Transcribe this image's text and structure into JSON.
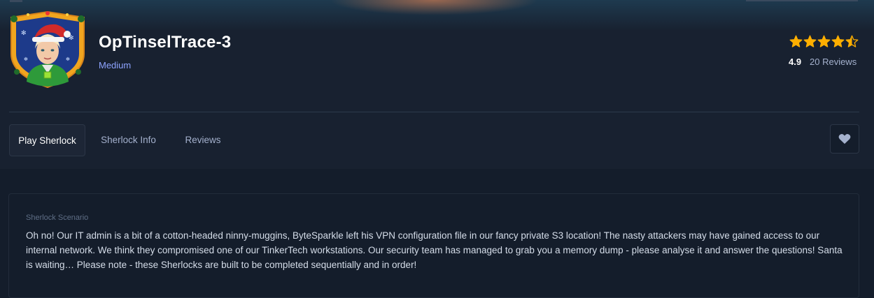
{
  "challenge": {
    "title": "OpTinselTrace-3",
    "difficulty": "Medium",
    "rating": "4.9",
    "reviews_label": "20 Reviews",
    "stars_filled": 4.5
  },
  "tabs": [
    {
      "label": "Play Sherlock",
      "active": true
    },
    {
      "label": "Sherlock Info",
      "active": false
    },
    {
      "label": "Reviews",
      "active": false
    }
  ],
  "favorite": {
    "icon": "heart-icon"
  },
  "scenario": {
    "label": "Sherlock Scenario",
    "text": "Oh no! Our IT admin is a bit of a cotton-headed ninny-muggins, ByteSparkle left his VPN configuration file in our fancy private S3 location! The nasty attackers may have gained access to our internal network. We think they compromised one of our TinkerTech workstations. Our security team has managed to grab you a memory dump - please analyse it and answer the questions! Santa is waiting…   Please note - these Sherlocks are built to be completed sequentially and in order!"
  },
  "colors": {
    "background": "#141d2b",
    "header": "#182130",
    "accent_difficulty": "#8ea4ff",
    "star": "#ffaf00",
    "text_muted": "#a4b1cd"
  }
}
